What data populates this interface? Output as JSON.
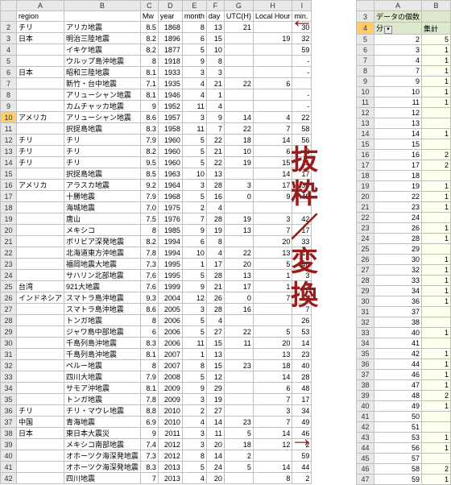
{
  "left": {
    "cols": [
      "",
      "A",
      "B",
      "C",
      "D",
      "E",
      "F",
      "G",
      "H",
      "I"
    ],
    "headers": [
      "",
      "region",
      "",
      "Mw",
      "year",
      "month",
      "day",
      "UTC(H)",
      "Local Hour",
      "min."
    ],
    "rows": [
      {
        "n": 2,
        "d": [
          "チリ",
          "アリカ地震",
          "8.5",
          "1868",
          "8",
          "13",
          "21",
          "",
          "30"
        ]
      },
      {
        "n": 3,
        "d": [
          "日本",
          "明治三陸地震",
          "8.2",
          "1896",
          "6",
          "15",
          "",
          "19",
          "32"
        ]
      },
      {
        "n": 4,
        "d": [
          "",
          "イキケ地震",
          "8.2",
          "1877",
          "5",
          "10",
          "",
          "",
          "59"
        ]
      },
      {
        "n": 5,
        "d": [
          "",
          "ウルップ島沖地震",
          "8",
          "1918",
          "9",
          "8",
          "",
          "",
          "-"
        ]
      },
      {
        "n": 6,
        "d": [
          "日本",
          "昭和三陸地震",
          "8.1",
          "1933",
          "3",
          "3",
          "",
          "",
          "-"
        ]
      },
      {
        "n": 7,
        "d": [
          "",
          "新竹・台中地震",
          "7.1",
          "1935",
          "4",
          "21",
          "22",
          "6",
          ""
        ]
      },
      {
        "n": 8,
        "d": [
          "",
          "アリューシャン地震",
          "8.1",
          "1946",
          "4",
          "1",
          "",
          "",
          "-"
        ]
      },
      {
        "n": 9,
        "d": [
          "",
          "カムチャッカ地震",
          "9",
          "1952",
          "11",
          "4",
          "",
          "",
          "-"
        ]
      },
      {
        "n": 10,
        "d": [
          "アメリカ",
          "アリューシャン地震",
          "8.6",
          "1957",
          "3",
          "9",
          "14",
          "4",
          "22"
        ],
        "sel": true
      },
      {
        "n": 11,
        "d": [
          "",
          "択捉島地震",
          "8.3",
          "1958",
          "11",
          "7",
          "22",
          "7",
          "58"
        ]
      },
      {
        "n": 12,
        "d": [
          "チリ",
          "チリ",
          "7.9",
          "1960",
          "5",
          "22",
          "18",
          "14",
          "56"
        ]
      },
      {
        "n": 13,
        "d": [
          "チリ",
          "チリ",
          "8.2",
          "1960",
          "5",
          "21",
          "10",
          "6",
          "2"
        ]
      },
      {
        "n": 14,
        "d": [
          "チリ",
          "チリ",
          "9.5",
          "1960",
          "5",
          "22",
          "19",
          "15",
          "11"
        ]
      },
      {
        "n": 15,
        "d": [
          "",
          "択捉島地震",
          "8.5",
          "1963",
          "10",
          "13",
          "",
          "14",
          "17"
        ]
      },
      {
        "n": 16,
        "d": [
          "アメリカ",
          "アラスカ地震",
          "9.2",
          "1964",
          "3",
          "28",
          "3",
          "17",
          "36"
        ]
      },
      {
        "n": 17,
        "d": [
          "",
          "十勝地震",
          "7.9",
          "1968",
          "5",
          "16",
          "0",
          "9",
          "48"
        ]
      },
      {
        "n": 18,
        "d": [
          "",
          "海城地震",
          "7.0",
          "1975",
          "2",
          "4",
          "",
          "",
          ""
        ]
      },
      {
        "n": 19,
        "d": [
          "",
          "唐山",
          "7.5",
          "1976",
          "7",
          "28",
          "19",
          "3",
          "42"
        ]
      },
      {
        "n": 20,
        "d": [
          "",
          "メキシコ",
          "8",
          "1985",
          "9",
          "19",
          "13",
          "7",
          "17"
        ]
      },
      {
        "n": 21,
        "d": [
          "",
          "ボリビア深発地震",
          "8.2",
          "1994",
          "6",
          "8",
          "",
          "20",
          "33"
        ]
      },
      {
        "n": 22,
        "d": [
          "",
          "北海道東方沖地震",
          "7.8",
          "1994",
          "10",
          "4",
          "22",
          "13",
          "19"
        ]
      },
      {
        "n": 23,
        "d": [
          "",
          "福岡地震大地震",
          "7.3",
          "1995",
          "1",
          "17",
          "20",
          "5",
          "46"
        ]
      },
      {
        "n": 24,
        "d": [
          "",
          "サハリン北部地震",
          "7.6",
          "1995",
          "5",
          "28",
          "13",
          "1",
          "3"
        ]
      },
      {
        "n": 25,
        "d": [
          "台湾",
          "921大地震",
          "7.6",
          "1999",
          "9",
          "21",
          "17",
          "1",
          "47"
        ]
      },
      {
        "n": 26,
        "d": [
          "インドネシア",
          "スマトラ島沖地震",
          "9.3",
          "2004",
          "12",
          "26",
          "0",
          "7",
          "58"
        ]
      },
      {
        "n": 27,
        "d": [
          "",
          "スマトラ島沖地震",
          "8.6",
          "2005",
          "3",
          "28",
          "16",
          "",
          "7"
        ]
      },
      {
        "n": 28,
        "d": [
          "",
          "トンガ地震",
          "8",
          "2006",
          "5",
          "4",
          "",
          "",
          "26"
        ]
      },
      {
        "n": 29,
        "d": [
          "",
          "ジャワ島中部地震",
          "6",
          "2006",
          "5",
          "27",
          "22",
          "5",
          "53"
        ]
      },
      {
        "n": 30,
        "d": [
          "",
          "千島列島沖地震",
          "8.3",
          "2006",
          "11",
          "15",
          "11",
          "20",
          "14"
        ]
      },
      {
        "n": 31,
        "d": [
          "",
          "千島列島沖地震",
          "8.1",
          "2007",
          "1",
          "13",
          "",
          "13",
          "23"
        ]
      },
      {
        "n": 32,
        "d": [
          "",
          "ペルー地震",
          "8",
          "2007",
          "8",
          "15",
          "23",
          "18",
          "40"
        ]
      },
      {
        "n": 33,
        "d": [
          "",
          "四川大地震",
          "7.9",
          "2008",
          "5",
          "12",
          "",
          "14",
          "28"
        ]
      },
      {
        "n": 34,
        "d": [
          "",
          "サモア沖地震",
          "8.1",
          "2009",
          "9",
          "29",
          "",
          "6",
          "48"
        ]
      },
      {
        "n": 35,
        "d": [
          "",
          "トンガ地震",
          "7.8",
          "2009",
          "3",
          "19",
          "",
          "7",
          "17"
        ]
      },
      {
        "n": 36,
        "d": [
          "チリ",
          "チリ・マウレ地震",
          "8.8",
          "2010",
          "2",
          "27",
          "",
          "3",
          "34"
        ]
      },
      {
        "n": 37,
        "d": [
          "中国",
          "青海地震",
          "6.9",
          "2010",
          "4",
          "14",
          "23",
          "7",
          "49"
        ]
      },
      {
        "n": 38,
        "d": [
          "日本",
          "東日本大震災",
          "9",
          "2011",
          "3",
          "11",
          "5",
          "14",
          "46"
        ]
      },
      {
        "n": 39,
        "d": [
          "",
          "メキシコ南部地震",
          "7.4",
          "2012",
          "3",
          "20",
          "18",
          "12",
          "2"
        ]
      },
      {
        "n": 40,
        "d": [
          "",
          "オホーツク海深発地震",
          "7.3",
          "2012",
          "8",
          "14",
          "2",
          "",
          "59"
        ]
      },
      {
        "n": 41,
        "d": [
          "",
          "オホーツク海深発地震",
          "8.3",
          "2013",
          "5",
          "24",
          "5",
          "14",
          "44"
        ]
      },
      {
        "n": 42,
        "d": [
          "",
          "四川地震",
          "7",
          "2013",
          "4",
          "20",
          "",
          "8",
          "2"
        ]
      }
    ]
  },
  "right": {
    "cols": [
      "",
      "A",
      "B"
    ],
    "headers": [
      "3",
      "データの個数",
      ""
    ],
    "sub": [
      "4",
      "分",
      "集計"
    ],
    "rows": [
      {
        "n": 5,
        "d": [
          "2",
          "5"
        ]
      },
      {
        "n": 6,
        "d": [
          "3",
          "1"
        ]
      },
      {
        "n": 7,
        "d": [
          "4",
          "1"
        ]
      },
      {
        "n": 8,
        "d": [
          "7",
          "1"
        ]
      },
      {
        "n": 9,
        "d": [
          "9",
          "1"
        ]
      },
      {
        "n": 10,
        "d": [
          "10",
          "1"
        ]
      },
      {
        "n": 11,
        "d": [
          "11",
          "1"
        ]
      },
      {
        "n": 12,
        "d": [
          "12",
          ""
        ]
      },
      {
        "n": 13,
        "d": [
          "13",
          ""
        ]
      },
      {
        "n": 14,
        "d": [
          "14",
          "1"
        ]
      },
      {
        "n": 15,
        "d": [
          "15",
          ""
        ]
      },
      {
        "n": 16,
        "d": [
          "16",
          "2"
        ]
      },
      {
        "n": 17,
        "d": [
          "17",
          "2"
        ]
      },
      {
        "n": 18,
        "d": [
          "18",
          ""
        ]
      },
      {
        "n": 19,
        "d": [
          "19",
          "1"
        ]
      },
      {
        "n": 20,
        "d": [
          "22",
          "1"
        ]
      },
      {
        "n": 21,
        "d": [
          "23",
          "1"
        ]
      },
      {
        "n": 22,
        "d": [
          "24",
          ""
        ]
      },
      {
        "n": 23,
        "d": [
          "26",
          "1"
        ]
      },
      {
        "n": 24,
        "d": [
          "28",
          "1"
        ]
      },
      {
        "n": 25,
        "d": [
          "29",
          ""
        ]
      },
      {
        "n": 26,
        "d": [
          "30",
          "1"
        ]
      },
      {
        "n": 27,
        "d": [
          "32",
          "1"
        ]
      },
      {
        "n": 28,
        "d": [
          "33",
          "1"
        ]
      },
      {
        "n": 29,
        "d": [
          "34",
          "1"
        ]
      },
      {
        "n": 30,
        "d": [
          "36",
          "1"
        ]
      },
      {
        "n": 31,
        "d": [
          "37",
          ""
        ]
      },
      {
        "n": 32,
        "d": [
          "38",
          ""
        ]
      },
      {
        "n": 33,
        "d": [
          "40",
          "1"
        ]
      },
      {
        "n": 34,
        "d": [
          "41",
          ""
        ]
      },
      {
        "n": 35,
        "d": [
          "42",
          "1"
        ]
      },
      {
        "n": 36,
        "d": [
          "44",
          "1"
        ]
      },
      {
        "n": 37,
        "d": [
          "46",
          "1"
        ]
      },
      {
        "n": 38,
        "d": [
          "47",
          "1"
        ]
      },
      {
        "n": 39,
        "d": [
          "48",
          "2"
        ]
      },
      {
        "n": 40,
        "d": [
          "49",
          "1"
        ]
      },
      {
        "n": 41,
        "d": [
          "50",
          ""
        ]
      },
      {
        "n": 42,
        "d": [
          "51",
          ""
        ]
      },
      {
        "n": 43,
        "d": [
          "53",
          "1"
        ]
      },
      {
        "n": 44,
        "d": [
          "56",
          "1"
        ]
      },
      {
        "n": 45,
        "d": [
          "57",
          ""
        ]
      },
      {
        "n": 46,
        "d": [
          "58",
          "2"
        ]
      },
      {
        "n": 47,
        "d": [
          "59",
          "1"
        ]
      }
    ]
  },
  "annot": {
    "top": "←",
    "text": "抜粋／変換",
    "bot": "→"
  }
}
